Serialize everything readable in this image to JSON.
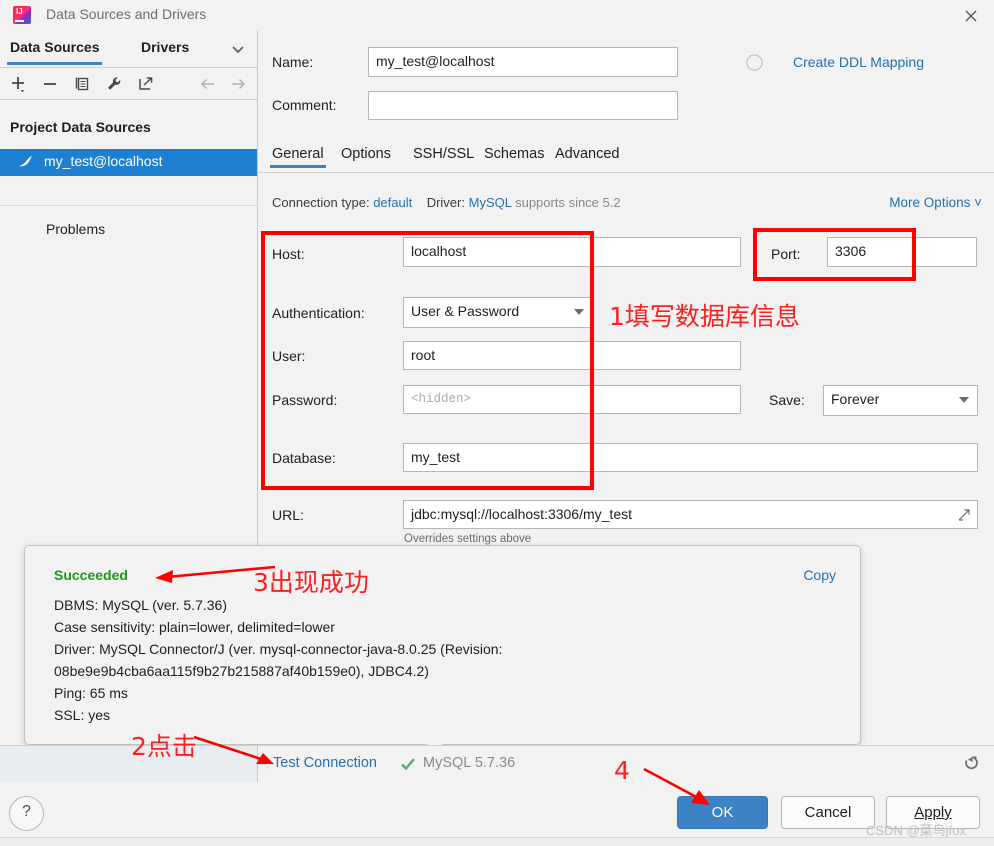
{
  "window": {
    "title": "Data Sources and Drivers",
    "logo_icon": "intellij-idea-logo",
    "close_icon": "close-icon"
  },
  "sidebar": {
    "tabs": [
      {
        "label": "Data Sources",
        "active": true
      },
      {
        "label": "Drivers",
        "active": false
      }
    ],
    "chevron_icon": "chevron-down-icon",
    "toolbar": [
      {
        "name": "add",
        "icon": "plus-icon"
      },
      {
        "name": "remove",
        "icon": "minus-icon"
      },
      {
        "name": "duplicate",
        "icon": "copy-icon"
      },
      {
        "name": "properties",
        "icon": "wrench-icon"
      },
      {
        "name": "open-externally",
        "icon": "external-link-icon"
      },
      {
        "name": "back",
        "icon": "arrow-left-icon"
      },
      {
        "name": "forward",
        "icon": "arrow-right-icon"
      }
    ],
    "section_title": "Project Data Sources",
    "items": [
      {
        "label": "my_test@localhost",
        "icon": "mysql-dolphin-icon",
        "selected": true
      }
    ],
    "problems_label": "Problems"
  },
  "header": {
    "name_label": "Name:",
    "name_value": "my_test@localhost",
    "name_status_icon": "circle-icon",
    "comment_label": "Comment:",
    "comment_value": "",
    "comment_expand_icon": "expand-icon",
    "create_ddl_link": "Create DDL Mapping"
  },
  "tabs": [
    {
      "label": "General",
      "active": true
    },
    {
      "label": "Options",
      "active": false
    },
    {
      "label": "SSH/SSL",
      "active": false
    },
    {
      "label": "Schemas",
      "active": false
    },
    {
      "label": "Advanced",
      "active": false
    }
  ],
  "meta": {
    "connection_type_label": "Connection type:",
    "connection_type_value": "default",
    "driver_label": "Driver:",
    "driver_value": "MySQL",
    "driver_note": "supports since 5.2",
    "more_options": "More Options",
    "more_options_icon": "chevron-down-icon"
  },
  "form": {
    "host_label": "Host:",
    "host_value": "localhost",
    "port_label": "Port:",
    "port_value": "3306",
    "authentication_label": "Authentication:",
    "authentication_value": "User & Password",
    "user_label": "User:",
    "user_value": "root",
    "password_label": "Password:",
    "password_placeholder": "<hidden>",
    "save_label": "Save:",
    "save_value": "Forever",
    "database_label": "Database:",
    "database_value": "my_test",
    "url_label": "URL:",
    "url_value": "jdbc:mysql://localhost:3306/my_test",
    "url_expand_icon": "expand-icon",
    "url_hint": "Overrides settings above"
  },
  "result": {
    "status": "Succeeded",
    "copy_label": "Copy",
    "lines": [
      "DBMS: MySQL (ver. 5.7.36)",
      "Case sensitivity: plain=lower, delimited=lower",
      "Driver: MySQL Connector/J (ver. mysql-connector-java-8.0.25 (Revision:",
      "08be9e9b4cba6aa115f9b27b215887af40b159e0), JDBC4.2)",
      "Ping: 65 ms",
      "SSL: yes"
    ]
  },
  "status_bar": {
    "test_connection": "Test Connection",
    "check_icon": "check-icon",
    "db_version": "MySQL 5.7.36",
    "reset_icon": "reset-icon"
  },
  "footer": {
    "help_label": "?",
    "ok_label": "OK",
    "cancel_label": "Cancel",
    "apply_label": "Apply"
  },
  "annotations": {
    "accent_color": "#fe0000",
    "note1": "1填写数据库信息",
    "note2": "2点击",
    "note3": "3出现成功"
  },
  "watermark": "CSDN @菜鸟jfox"
}
